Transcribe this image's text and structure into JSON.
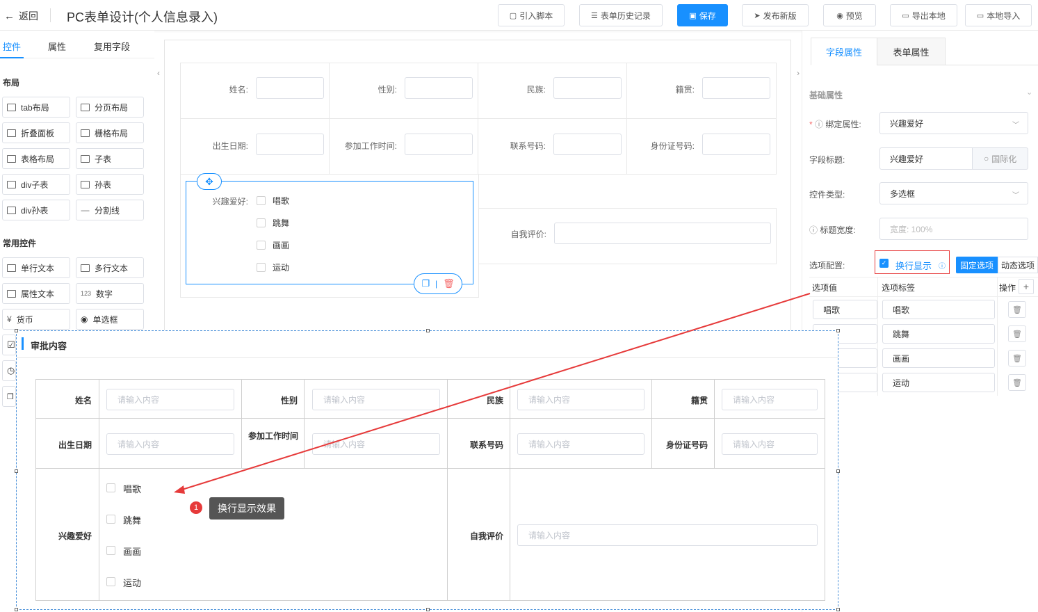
{
  "header": {
    "back_label": "返回",
    "title": "PC表单设计(个人信息录入)",
    "buttons": [
      {
        "label": "引入脚本",
        "icon": "script-icon"
      },
      {
        "label": "表单历史记录",
        "icon": "list-icon"
      },
      {
        "label": "保存",
        "icon": "save-icon"
      },
      {
        "label": "发布新版",
        "icon": "send-icon"
      },
      {
        "label": "预览",
        "icon": "eye-icon"
      },
      {
        "label": "导出本地",
        "icon": "folder-icon"
      },
      {
        "label": "本地导入",
        "icon": "folder-open-icon"
      }
    ]
  },
  "left_panel": {
    "tabs": [
      "控件",
      "属性",
      "复用字段"
    ],
    "sections": {
      "layout_title": "布局",
      "layout_items": [
        "tab布局",
        "分页布局",
        "折叠面板",
        "栅格布局",
        "表格布局",
        "子表",
        "div子表",
        "孙表",
        "div孙表",
        "分割线"
      ],
      "common_title": "常用控件",
      "common_items": [
        "单行文本",
        "多行文本",
        "属性文本",
        "数字",
        "货币",
        "单选框"
      ]
    }
  },
  "canvas": {
    "row1": [
      "姓名:",
      "性别:",
      "民族:",
      "籍贯:"
    ],
    "row2": [
      "出生日期:",
      "参加工作时间:",
      "联系号码:",
      "身份证号码:"
    ],
    "hobby_label": "兴趣爱好:",
    "hobby_options": [
      "唱歌",
      "跳舞",
      "画画",
      "运动"
    ],
    "self_eval_label": "自我评价:"
  },
  "right_panel": {
    "tabs": [
      "字段属性",
      "表单属性"
    ],
    "section_title": "基础属性",
    "bind_label": "绑定属性:",
    "bind_value": "兴趣爱好",
    "field_title_label": "字段标题:",
    "field_title_value": "兴趣爱好",
    "i18n_label": "国际化",
    "control_type_label": "控件类型:",
    "control_type_value": "多选框",
    "title_width_label": "标题宽度:",
    "title_width_placeholder": "宽度: 100%",
    "options_config_label": "选项配置:",
    "wrap_display_label": "换行显示",
    "fixed_options_label": "固定选项",
    "dynamic_options_label": "动态选项",
    "table_headers": [
      "选项值",
      "选项标签",
      "操作"
    ],
    "options": [
      {
        "value": "唱歌",
        "label": "唱歌"
      },
      {
        "value": "",
        "label": "跳舞"
      },
      {
        "value": "",
        "label": "画画"
      },
      {
        "value": "",
        "label": "运动"
      }
    ]
  },
  "preview": {
    "section_title": "审批内容",
    "row1": [
      "姓名",
      "性别",
      "民族",
      "籍贯"
    ],
    "row2": [
      "出生日期",
      "参加工作时间",
      "联系号码",
      "身份证号码"
    ],
    "placeholder": "请输入内容",
    "hobby_label": "兴趣爱好",
    "hobby_options": [
      "唱歌",
      "跳舞",
      "画画",
      "运动"
    ],
    "self_eval_label": "自我评价"
  },
  "annotation": {
    "badge": "1",
    "text": "换行显示效果",
    "color": "#e63a3a"
  },
  "colors": {
    "primary": "#1890ff",
    "border": "#dcdfe6",
    "annotation": "#e63a3a"
  }
}
